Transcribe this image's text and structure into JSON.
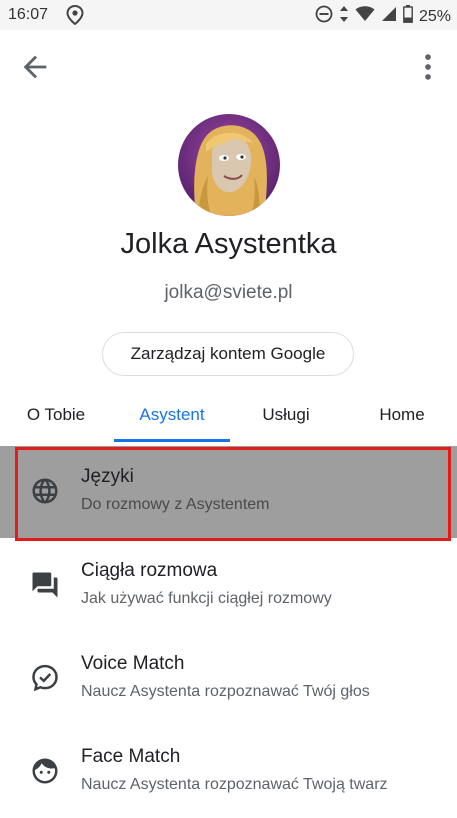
{
  "status_bar": {
    "time": "16:07",
    "battery": "25%"
  },
  "profile": {
    "name": "Jolka Asystentka",
    "email": "jolka@sviete.pl",
    "manage_button": "Zarządzaj kontem Google"
  },
  "tabs": [
    {
      "label": "O Tobie"
    },
    {
      "label": "Asystent"
    },
    {
      "label": "Usługi"
    },
    {
      "label": "Home"
    }
  ],
  "active_tab": "Asystent",
  "settings": [
    {
      "title": "Języki",
      "subtitle": "Do rozmowy z Asystentem",
      "icon": "globe-icon",
      "highlighted": true
    },
    {
      "title": "Ciągła rozmowa",
      "subtitle": "Jak używać funkcji ciągłej rozmowy",
      "icon": "chat-icon"
    },
    {
      "title": "Voice Match",
      "subtitle": "Naucz Asystenta rozpoznawać Twój głos",
      "icon": "voice-match-icon"
    },
    {
      "title": "Face Match",
      "subtitle": "Naucz Asystenta rozpoznawać Twoją twarz",
      "icon": "face-icon"
    }
  ],
  "colors": {
    "accent": "#1a73e8",
    "highlight_border": "#e41b1b",
    "highlight_bg": "#9e9e9e"
  }
}
